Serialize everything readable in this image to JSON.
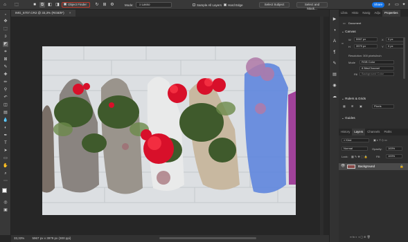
{
  "options_bar": {
    "object_finder_label": "Object Finder",
    "mode_label": "Mode:",
    "mode_value": "Lasso",
    "sample_all_layers_label": "Sample All Layers",
    "hard_edge_label": "Hard Edge",
    "select_subject_label": "Select Subject",
    "select_and_mask_label": "Select and Mask...",
    "share_label": "Share"
  },
  "document": {
    "tab_title": "IMG_6707.CR2 @ 33,3% (RGB/8*)"
  },
  "status": {
    "zoom": "33,33%",
    "info": "5967 px x 3979 px (300 ppi)"
  },
  "panels": {
    "top_tabs": [
      "Libra",
      "Histo",
      "Navig",
      "Adju",
      "Properties"
    ],
    "active_top_tab": "Properties",
    "document_label": "Document",
    "canvas_section": "Canvas",
    "width_label": "W",
    "width_value": "5967 px",
    "height_label": "H",
    "height_value": "3979 px",
    "x_label": "X",
    "x_value": "0 px",
    "y_label": "Y",
    "y_value": "0 px",
    "resolution": "Resolution: 300 pixels/inch",
    "mode_label": "Mode",
    "mode_value": "RGB Color",
    "bits_value": "8 Bits/Channel",
    "fill_label": "Fill",
    "fill_value": "Background Color",
    "rulers_section": "Rulers & Grids",
    "units_value": "Pixels",
    "guides_section": "Guides",
    "bottom_tabs": [
      "History",
      "Layers",
      "Channels",
      "Paths"
    ],
    "active_bottom_tab": "Layers",
    "kind_label": "Kind",
    "blend_value": "Normal",
    "opacity_label": "Opacity:",
    "opacity_value": "100%",
    "lock_label": "Lock:",
    "fill_pct_label": "Fill:",
    "fill_pct_value": "100%",
    "layer_name": "Background"
  }
}
